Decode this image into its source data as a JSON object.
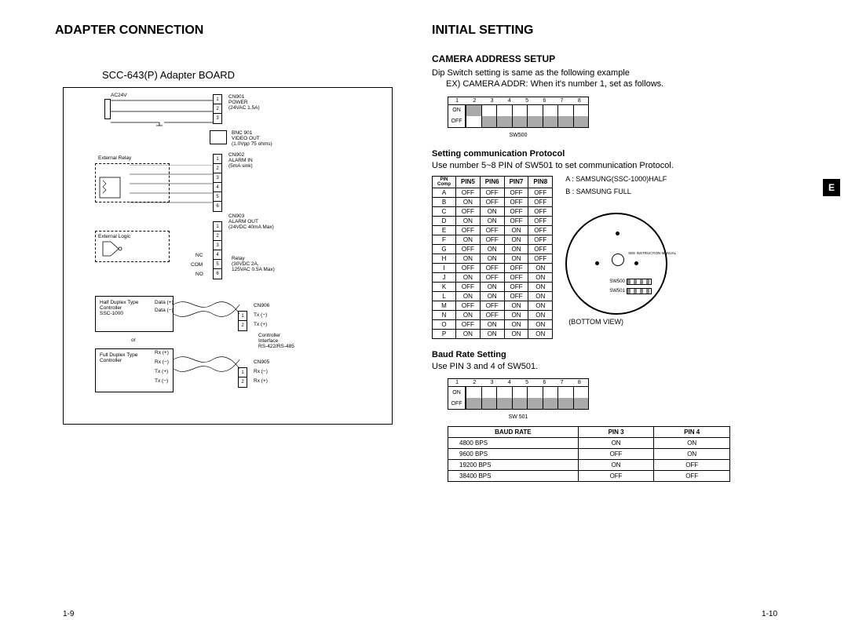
{
  "left": {
    "title": "ADAPTER CONNECTION",
    "board_title": "SCC-643(P) Adapter BOARD",
    "page_num": "1-9",
    "labels": {
      "ac24v": "AC24V",
      "cn901": "CN901\nPOWER\n(24VAC 1.5A)",
      "bnc901": "BNC 901\nVIDEO OUT\n(1.0Vpp 75 ohms)",
      "cn902": "CN902\nALARM  IN\n(5mA sink)",
      "ext_relay": "External   Relay",
      "cn903": "CN903\nALARM OUT\n(24VDC 40mA Max)",
      "ext_logic": "External        Logic",
      "nc": "NC",
      "com": "COM",
      "no": "NO",
      "relay": "Relay\n(30VDC 2A,\n125VAC 0.5A Max)",
      "half_duplex": "Half Duplex Type\nController\nSSC-1000",
      "data_p": "Data (+)",
      "data_n": "Data (−)",
      "or": "or",
      "full_duplex": "Full Duplex Type\nController",
      "rx_p": "Rx (+)",
      "rx_n": "Rx (−)",
      "tx_p": "Tx (+)",
      "tx_n": "Tx (−)",
      "cn906": "CN906",
      "cn906_1": "Tx (−)",
      "cn906_2": "Tx (+)",
      "ctrl_if": "Controller\nInterface\nRS-422/RS-485",
      "cn905": "CN905",
      "cn905_1": "Rx (−)",
      "cn905_2": "Rx (+)"
    }
  },
  "right": {
    "title": "INITIAL SETTING",
    "page_num": "1-10",
    "camera_setup_h": "CAMERA ADDRESS SETUP",
    "camera_setup_p1": "Dip Switch setting is same as the following example",
    "camera_setup_p2": "EX) CAMERA ADDR: When it's number 1, set as follows.",
    "sw500_caption": "SW500",
    "proto_h": "Setting communication Protocol",
    "proto_p": "Use number 5~8 PIN of SW501 to set communication Protocol.",
    "proto_header_tl": "PIN\nComp",
    "proto_headers": [
      "PIN5",
      "PIN6",
      "PIN7",
      "PIN8"
    ],
    "proto_rows": [
      {
        "k": "A",
        "v": [
          "OFF",
          "OFF",
          "OFF",
          "OFF"
        ]
      },
      {
        "k": "B",
        "v": [
          "ON",
          "OFF",
          "OFF",
          "OFF"
        ]
      },
      {
        "k": "C",
        "v": [
          "OFF",
          "ON",
          "OFF",
          "OFF"
        ]
      },
      {
        "k": "D",
        "v": [
          "ON",
          "ON",
          "OFF",
          "OFF"
        ]
      },
      {
        "k": "E",
        "v": [
          "OFF",
          "OFF",
          "ON",
          "OFF"
        ]
      },
      {
        "k": "F",
        "v": [
          "ON",
          "OFF",
          "ON",
          "OFF"
        ]
      },
      {
        "k": "G",
        "v": [
          "OFF",
          "ON",
          "ON",
          "OFF"
        ]
      },
      {
        "k": "H",
        "v": [
          "ON",
          "ON",
          "ON",
          "OFF"
        ]
      },
      {
        "k": "I",
        "v": [
          "OFF",
          "OFF",
          "OFF",
          "ON"
        ]
      },
      {
        "k": "J",
        "v": [
          "ON",
          "OFF",
          "OFF",
          "ON"
        ]
      },
      {
        "k": "K",
        "v": [
          "OFF",
          "ON",
          "OFF",
          "ON"
        ]
      },
      {
        "k": "L",
        "v": [
          "ON",
          "ON",
          "OFF",
          "ON"
        ]
      },
      {
        "k": "M",
        "v": [
          "OFF",
          "OFF",
          "ON",
          "ON"
        ]
      },
      {
        "k": "N",
        "v": [
          "ON",
          "OFF",
          "ON",
          "ON"
        ]
      },
      {
        "k": "O",
        "v": [
          "OFF",
          "ON",
          "ON",
          "ON"
        ]
      },
      {
        "k": "P",
        "v": [
          "ON",
          "ON",
          "ON",
          "ON"
        ]
      }
    ],
    "legend_a": "A : SAMSUNG(SSC-1000)HALF",
    "legend_b": "B : SAMSUNG FULL",
    "bv_caption": "(BOTTOM VIEW)",
    "bv_note": "SEE INSTRUCTION MANUAL",
    "bv_sw500": "SW500",
    "bv_sw501": "SW501",
    "baud_h": "Baud Rate Setting",
    "baud_p": "Use PIN 3 and 4 of SW501.",
    "sw501_caption": "SW 501",
    "baud_headers": [
      "BAUD RATE",
      "PIN 3",
      "PIN 4"
    ],
    "baud_rows": [
      {
        "r": "4800 BPS",
        "p3": "ON",
        "p4": "ON"
      },
      {
        "r": "9600 BPS",
        "p3": "OFF",
        "p4": "ON"
      },
      {
        "r": "19200 BPS",
        "p3": "ON",
        "p4": "OFF"
      },
      {
        "r": "38400 BPS",
        "p3": "OFF",
        "p4": "OFF"
      }
    ],
    "side_tab": "E",
    "dip_on": "ON",
    "dip_off": "OFF",
    "dip_nums": [
      "1",
      "2",
      "3",
      "4",
      "5",
      "6",
      "7",
      "8"
    ]
  }
}
